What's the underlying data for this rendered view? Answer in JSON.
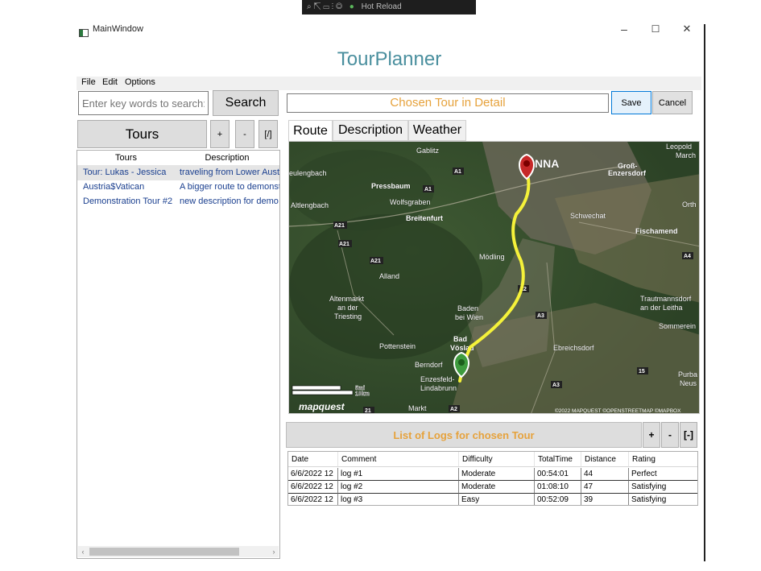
{
  "window": {
    "title": "MainWindow",
    "hot_reload_label": "Hot Reload",
    "minimize_label": "–",
    "maximize_label": "☐",
    "close_label": "✕"
  },
  "app_title": "TourPlanner",
  "menu": {
    "items": [
      "File",
      "Edit",
      "Options"
    ]
  },
  "search": {
    "placeholder": "Enter key words to search:",
    "button_label": "Search"
  },
  "tours_panel": {
    "tours_button": "Tours",
    "add_label": "+",
    "remove_label": "-",
    "edit_label": "[/]",
    "columns": [
      "Tours",
      "Description"
    ],
    "rows": [
      {
        "name": "Tour: Lukas - Jessica",
        "description": "traveling from Lower Austria",
        "selected": true
      },
      {
        "name": "Austria$Vatican",
        "description": "A bigger route to demonstrate",
        "selected": false
      },
      {
        "name": "Demonstration Tour #2",
        "description": "new description for demo tour",
        "selected": false
      }
    ],
    "scroll_left": "‹",
    "scroll_right": "›"
  },
  "detail": {
    "chosen_tour_label": "Chosen Tour in Detail",
    "save_label": "Save",
    "cancel_label": "Cancel",
    "tabs": [
      "Route",
      "Description",
      "Weather"
    ],
    "active_tab": "Route"
  },
  "map": {
    "places": [
      "Gablitz",
      "NNA",
      "Leopold",
      "March",
      "Groß-",
      "Enzersdorf",
      "eulengbach",
      "Pressbaum",
      "Wolfsgraben",
      "Altlengbach",
      "Breitenfurt",
      "Schwechat",
      "Orth",
      "Fischamend",
      "Mödling",
      "Alland",
      "Altenmarkt",
      "an der",
      "Triesting",
      "Baden",
      "bei Wien",
      "Trautmannsdorf",
      "an der Leitha",
      "Sommerein",
      "Bad",
      "Vöslau",
      "Pottenstein",
      "Ebreichsdorf",
      "Berndorf",
      "Purba",
      "Neus",
      "Enzesfeld-",
      "Lindabrunn",
      "Markt"
    ],
    "road_shields": [
      "A1",
      "A1",
      "A21",
      "A21",
      "A21",
      "A2",
      "A3",
      "A4",
      "A3",
      "15",
      "21",
      "A2"
    ],
    "scale_labels": [
      "5mi",
      "10km"
    ],
    "logo": "mapquest",
    "attribution": "©2022 MAPQUEST ©OPENSTREETMAP ©MAPBOX"
  },
  "logs": {
    "header_label": "List of Logs for chosen Tour",
    "add_label": "+",
    "remove_label": "-",
    "edit_label": "[-]",
    "columns": [
      "Date",
      "Comment",
      "Difficulty",
      "TotalTime",
      "Distance",
      "Rating"
    ],
    "rows": [
      {
        "date": "6/6/2022 12",
        "comment": "log #1",
        "difficulty": "Moderate",
        "total_time": "00:54:01",
        "distance": "44",
        "rating": "Perfect"
      },
      {
        "date": "6/6/2022 12",
        "comment": "log #2",
        "difficulty": "Moderate",
        "total_time": "01:08:10",
        "distance": "47",
        "rating": "Satisfying"
      },
      {
        "date": "6/6/2022 12",
        "comment": "log #3",
        "difficulty": "Easy",
        "total_time": "00:52:09",
        "distance": "39",
        "rating": "Satisfying"
      }
    ]
  },
  "colors": {
    "accent": "#4a8f9e",
    "highlight": "#e6a23c",
    "route": "#f5f23a"
  }
}
